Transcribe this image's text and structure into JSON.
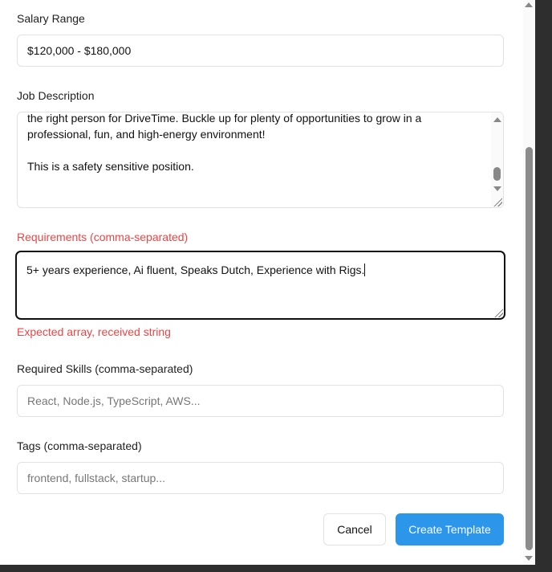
{
  "salary": {
    "label": "Salary Range",
    "value": "$120,000 - $180,000"
  },
  "description": {
    "label": "Job Description",
    "value": "the right person for DriveTime. Buckle up for plenty of opportunities to grow in a\nprofessional, fun, and high-energy environment!\n\nThis is a safety sensitive position."
  },
  "requirements": {
    "label": "Requirements (comma-separated)",
    "value": "5+ years experience, Ai fluent, Speaks Dutch, Experience with Rigs.",
    "error": "Expected array, received string"
  },
  "skills": {
    "label": "Required Skills (comma-separated)",
    "placeholder": "React, Node.js, TypeScript, AWS..."
  },
  "tags": {
    "label": "Tags (comma-separated)",
    "placeholder": "frontend, fullstack, startup..."
  },
  "actions": {
    "cancel": "Cancel",
    "create": "Create Template"
  },
  "colors": {
    "accent": "#2b96ea",
    "error": "#ef4444"
  }
}
